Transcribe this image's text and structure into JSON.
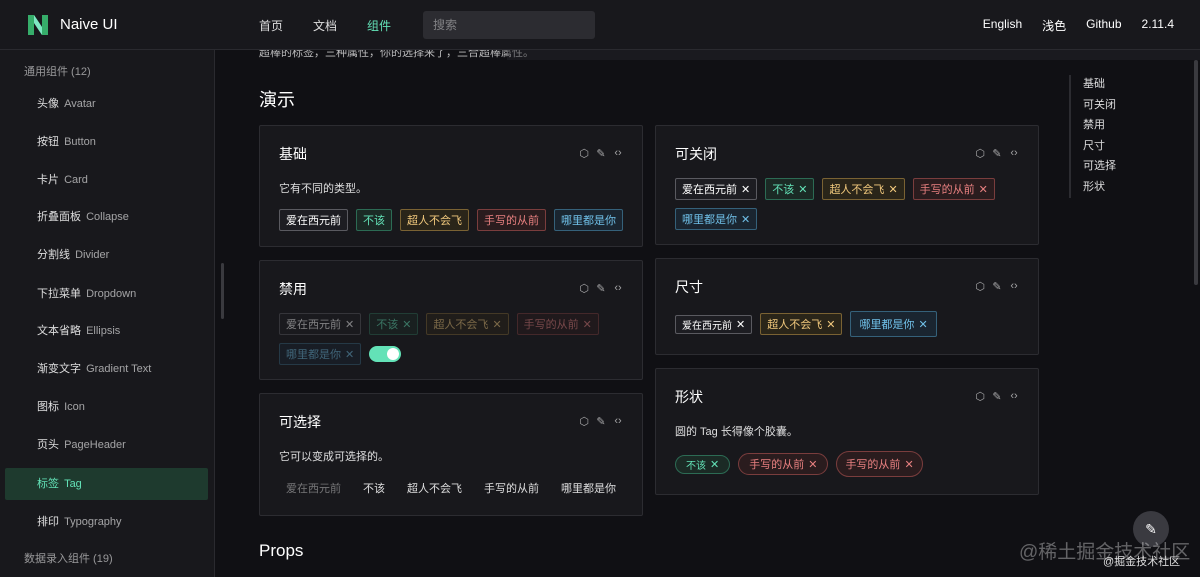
{
  "header": {
    "brand": "Naive UI",
    "nav": [
      "首页",
      "文档",
      "组件"
    ],
    "search_placeholder": "搜索",
    "right_nav": [
      "English",
      "浅色",
      "Github",
      "2.11.4"
    ]
  },
  "sidebar": {
    "group1": "通用组件 (12)",
    "items": [
      {
        "zh": "头像",
        "en": "Avatar"
      },
      {
        "zh": "按钮",
        "en": "Button"
      },
      {
        "zh": "卡片",
        "en": "Card"
      },
      {
        "zh": "折叠面板",
        "en": "Collapse"
      },
      {
        "zh": "分割线",
        "en": "Divider"
      },
      {
        "zh": "下拉菜单",
        "en": "Dropdown"
      },
      {
        "zh": "文本省略",
        "en": "Ellipsis"
      },
      {
        "zh": "渐变文字",
        "en": "Gradient Text"
      },
      {
        "zh": "图标",
        "en": "Icon"
      },
      {
        "zh": "页头",
        "en": "PageHeader"
      },
      {
        "zh": "标签",
        "en": "Tag"
      },
      {
        "zh": "排印",
        "en": "Typography"
      }
    ],
    "group2": "数据录入组件 (19)"
  },
  "main": {
    "truncated_text": "超棒的标签，三种属性，你的选择来了，三合超棒属性。",
    "section_title": "演示",
    "props_title": "Props"
  },
  "cards": {
    "basic": {
      "title": "基础",
      "desc": "它有不同的类型。",
      "tags": [
        "爱在西元前",
        "不该",
        "超人不会飞",
        "手写的从前",
        "哪里都是你"
      ]
    },
    "closable": {
      "title": "可关闭",
      "tags": [
        "爱在西元前",
        "不该",
        "超人不会飞",
        "手写的从前",
        "哪里都是你"
      ]
    },
    "disabled": {
      "title": "禁用",
      "tags": [
        "爱在西元前",
        "不该",
        "超人不会飞",
        "手写的从前",
        "哪里都是你"
      ]
    },
    "size": {
      "title": "尺寸",
      "tags": [
        "爱在西元前",
        "超人不会飞",
        "哪里都是你"
      ]
    },
    "checkable": {
      "title": "可选择",
      "desc": "它可以变成可选择的。",
      "tags": [
        "爱在西元前",
        "不该",
        "超人不会飞",
        "手写的从前",
        "哪里都是你"
      ]
    },
    "shape": {
      "title": "形状",
      "desc": "圆的 Tag 长得像个胶囊。",
      "tags": [
        "不该",
        "手写的从前",
        "手写的从前"
      ]
    }
  },
  "anchor": [
    "基础",
    "可关闭",
    "禁用",
    "尺寸",
    "可选择",
    "形状"
  ],
  "watermark": {
    "main": "@稀土掘金技术社区",
    "small": "@掘金技术社区"
  },
  "colors": {
    "primary": "#63e2b7",
    "warning": "#f2c97d",
    "error": "#e88080",
    "info": "#70c0e8"
  },
  "icons": {
    "card_tools": [
      "cube-icon",
      "edit-icon",
      "code-icon"
    ],
    "close": "close-icon",
    "fab": "edit-pen-icon"
  }
}
